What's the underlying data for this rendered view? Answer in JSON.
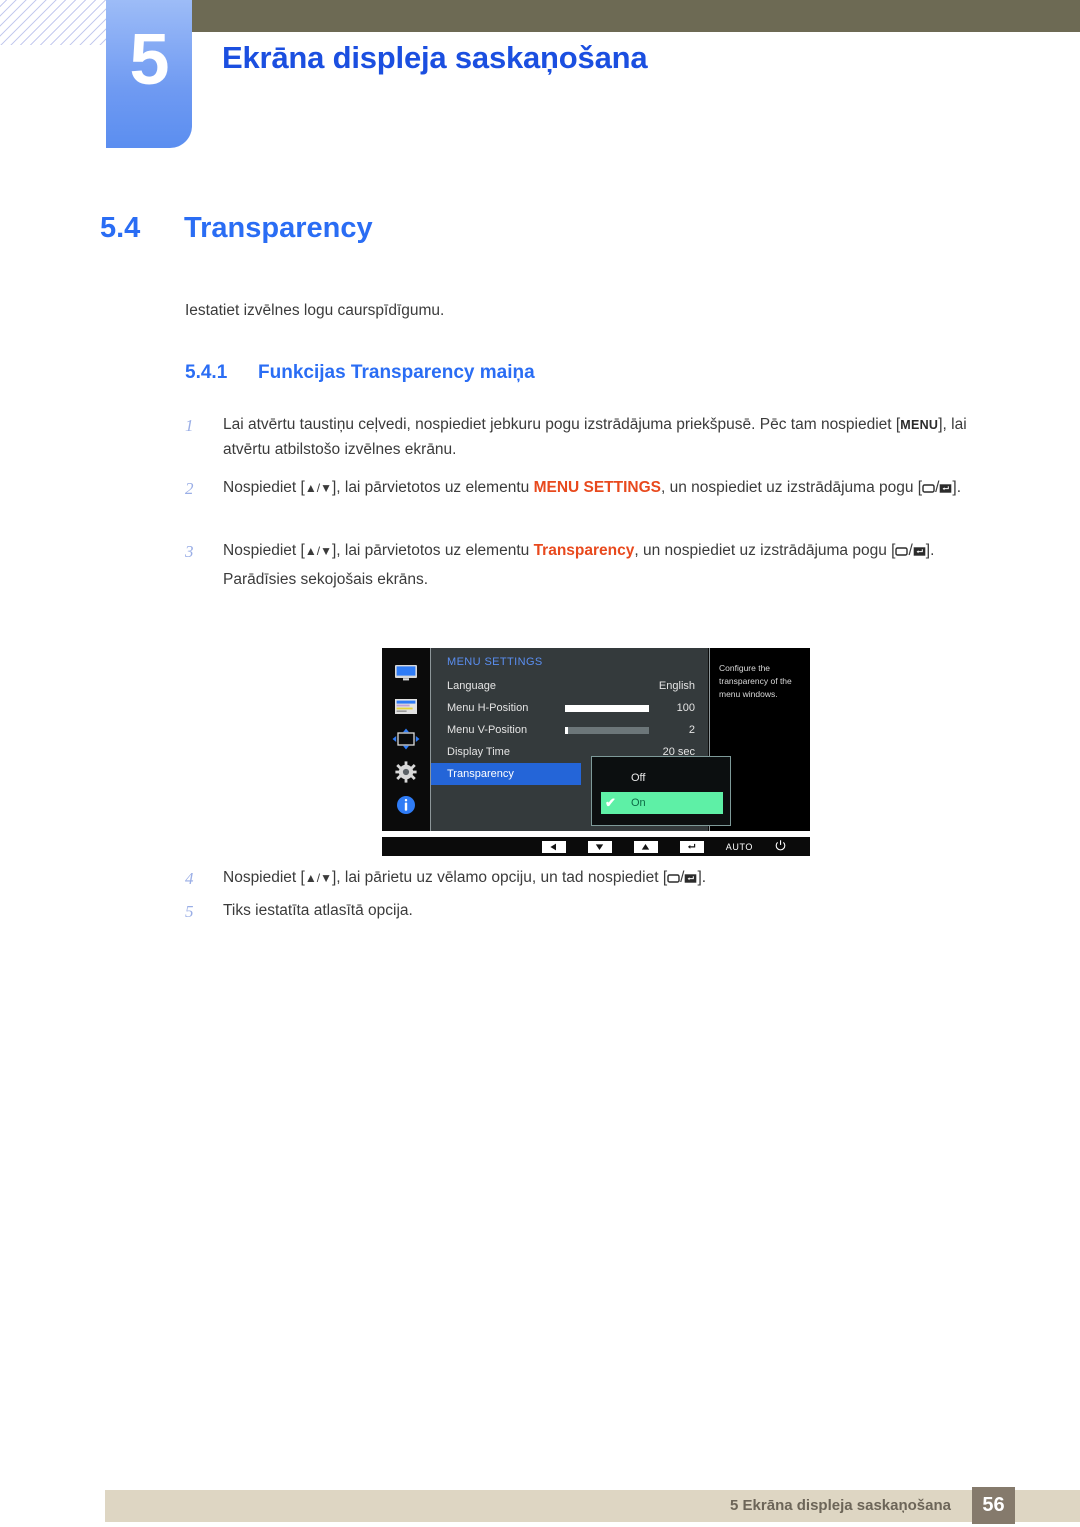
{
  "header": {
    "chapter_number": "5",
    "chapter_title": "Ekrāna displeja saskaņošana",
    "accent_blue": "#1b4fe0",
    "tab_blue": "#6f9af2",
    "olive": "#6d6a54"
  },
  "section": {
    "number": "5.4",
    "title": "Transparency",
    "intro": "Iestatiet izvēlnes logu caurspīdīgumu.",
    "sub_number": "5.4.1",
    "sub_title": "Funkcijas Transparency maiņa"
  },
  "steps": [
    {
      "index": "1",
      "text_a": "Lai atvērtu taustiņu ceļvedi, nospiediet jebkuru pogu izstrādājuma priekšpusē. Pēc tam nospiediet [",
      "key": "MENU",
      "text_b": "], lai atvērtu atbilstošo izvēlnes ekrānu."
    },
    {
      "index": "2",
      "text_a": "Nospiediet [",
      "arrows": "▲/▼",
      "text_b": "], lai pārvietotos uz elementu ",
      "highlight": "MENU SETTINGS",
      "text_c": ", un nospiediet uz izstrādājuma pogu [",
      "text_d": "]."
    },
    {
      "index": "3",
      "text_a": "Nospiediet [",
      "arrows": "▲/▼",
      "text_b": "], lai pārvietotos uz elementu ",
      "highlight": "Transparency",
      "text_c": ", un nospiediet uz izstrādājuma pogu [",
      "text_d": "].",
      "note": "Parādīsies sekojošais ekrāns."
    },
    {
      "index": "4",
      "text_a": "Nospiediet [",
      "arrows": "▲/▼",
      "text_b": "], lai pārietu uz vēlamo opciju, un tad nospiediet [",
      "text_d": "]."
    },
    {
      "index": "5",
      "text_a": "Tiks iestatīta atlasītā opcija."
    }
  ],
  "osd": {
    "title": "MENU SETTINGS",
    "rail_icons": [
      "monitor-icon",
      "picture-settings-icon",
      "position-arrows-icon",
      "gear-icon",
      "info-icon"
    ],
    "rows": [
      {
        "label": "Language",
        "value": "English",
        "slider": null
      },
      {
        "label": "Menu H-Position",
        "value": "100",
        "slider": 100
      },
      {
        "label": "Menu V-Position",
        "value": "2",
        "slider": 3
      },
      {
        "label": "Display Time",
        "value": "20 sec",
        "slider": null
      },
      {
        "label": "Transparency",
        "value": "",
        "slider": null
      }
    ],
    "selected_row": "Transparency",
    "popup": {
      "options": [
        "Off",
        "On"
      ],
      "selected": "On",
      "check_glyph": "✔",
      "highlight_color": "#5ef0a6"
    },
    "help_text": "Configure the transparency of the menu windows.",
    "keybar": {
      "buttons": [
        "left-arrow-icon",
        "down-arrow-icon",
        "up-arrow-icon",
        "enter-icon"
      ],
      "auto_label": "AUTO",
      "power_icon": "power-icon"
    },
    "highlight_blue": "#2465d8"
  },
  "footer": {
    "text": "5 Ekrāna displeja saskaņošana",
    "page": "56",
    "bar_color": "#ded6c3",
    "page_box_color": "#857a6c"
  }
}
